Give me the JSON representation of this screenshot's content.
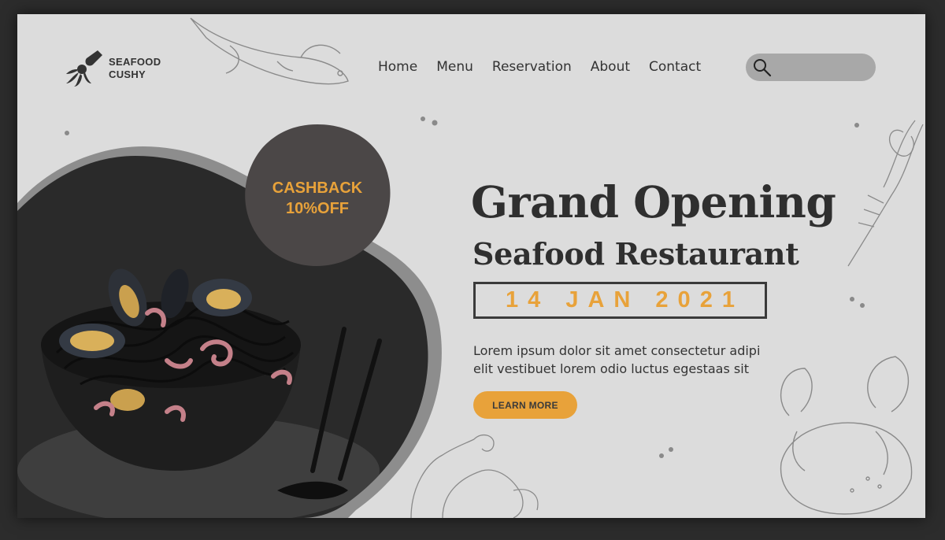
{
  "brand": {
    "line1": "SEAFOOD",
    "line2": "CUSHY"
  },
  "nav": {
    "items": [
      {
        "label": "Home"
      },
      {
        "label": "Menu"
      },
      {
        "label": "Reservation"
      },
      {
        "label": "About"
      },
      {
        "label": "Contact"
      }
    ]
  },
  "search": {
    "placeholder": "",
    "value": ""
  },
  "promo": {
    "line1": "CASHBACK",
    "line2": "10%OFF"
  },
  "hero": {
    "title": "Grand Opening",
    "subtitle": "Seafood Restaurant",
    "date": "14 JAN 2021",
    "description_line1": "Lorem ipsum dolor sit amet consectetur adipi",
    "description_line2": "elit vestibuet lorem odio luctus egestaas sit",
    "cta_label": "LEARN MORE"
  },
  "colors": {
    "accent": "#e8a23a",
    "dark": "#3a3a3a",
    "background": "#dcdcdc",
    "frame": "#2c2c2c"
  },
  "icons": {
    "logo": "squid-logo-icon",
    "search": "search-icon"
  }
}
